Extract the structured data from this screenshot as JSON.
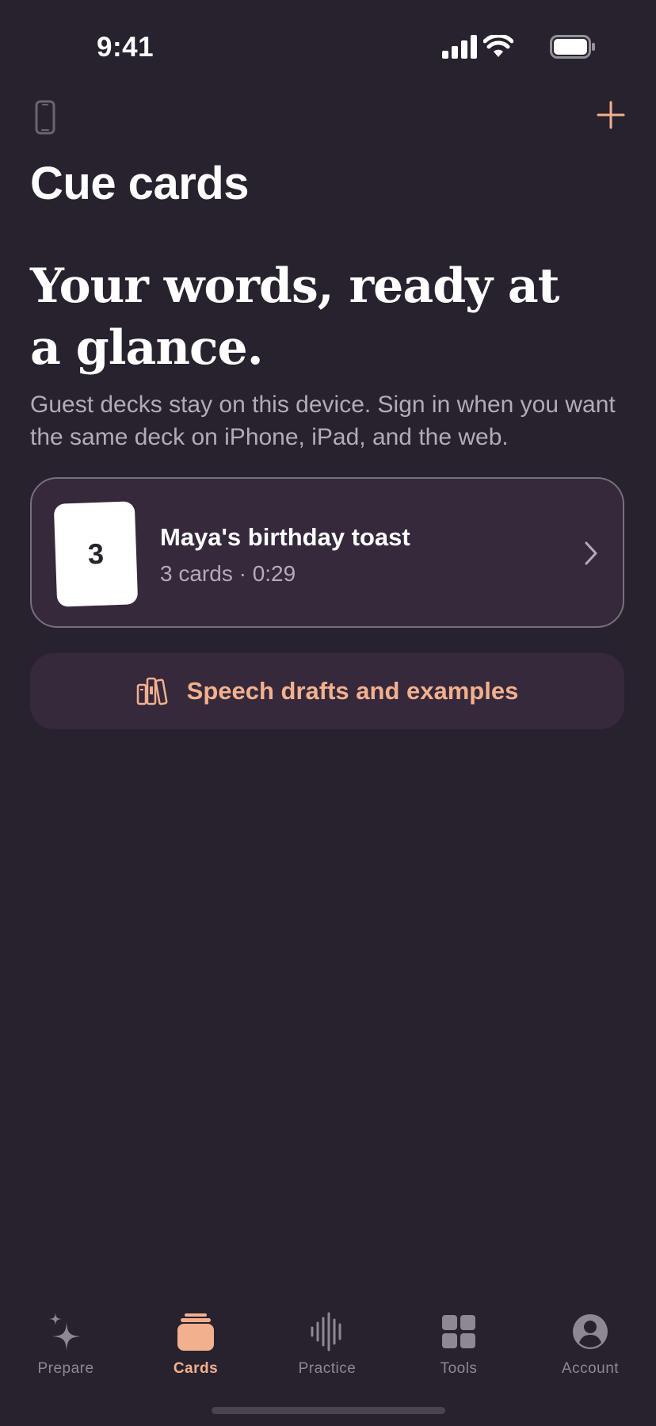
{
  "status_bar": {
    "time": "9:41"
  },
  "header": {
    "title": "Cue cards"
  },
  "hero": {
    "headline": "Your words, ready at a glance.",
    "subtitle": "Guest decks stay on this device. Sign in when you want the same deck on iPhone, iPad, and the web."
  },
  "deck": {
    "card_count_badge": "3",
    "name": "Maya's birthday toast",
    "meta": "3 cards · 0:29"
  },
  "drafts_button": {
    "label": "Speech drafts and examples"
  },
  "tabs": [
    {
      "label": "Prepare",
      "icon": "sparkles-icon",
      "active": false
    },
    {
      "label": "Cards",
      "icon": "cards-stack-icon",
      "active": true
    },
    {
      "label": "Practice",
      "icon": "waveform-icon",
      "active": false
    },
    {
      "label": "Tools",
      "icon": "grid-icon",
      "active": false
    },
    {
      "label": "Account",
      "icon": "person-circle-icon",
      "active": false
    }
  ],
  "colors": {
    "background": "#28222e",
    "card_background": "#35293b",
    "accent": "#f3b08e",
    "secondary_text": "#b3acb8",
    "inactive_tab": "#8e8893"
  }
}
